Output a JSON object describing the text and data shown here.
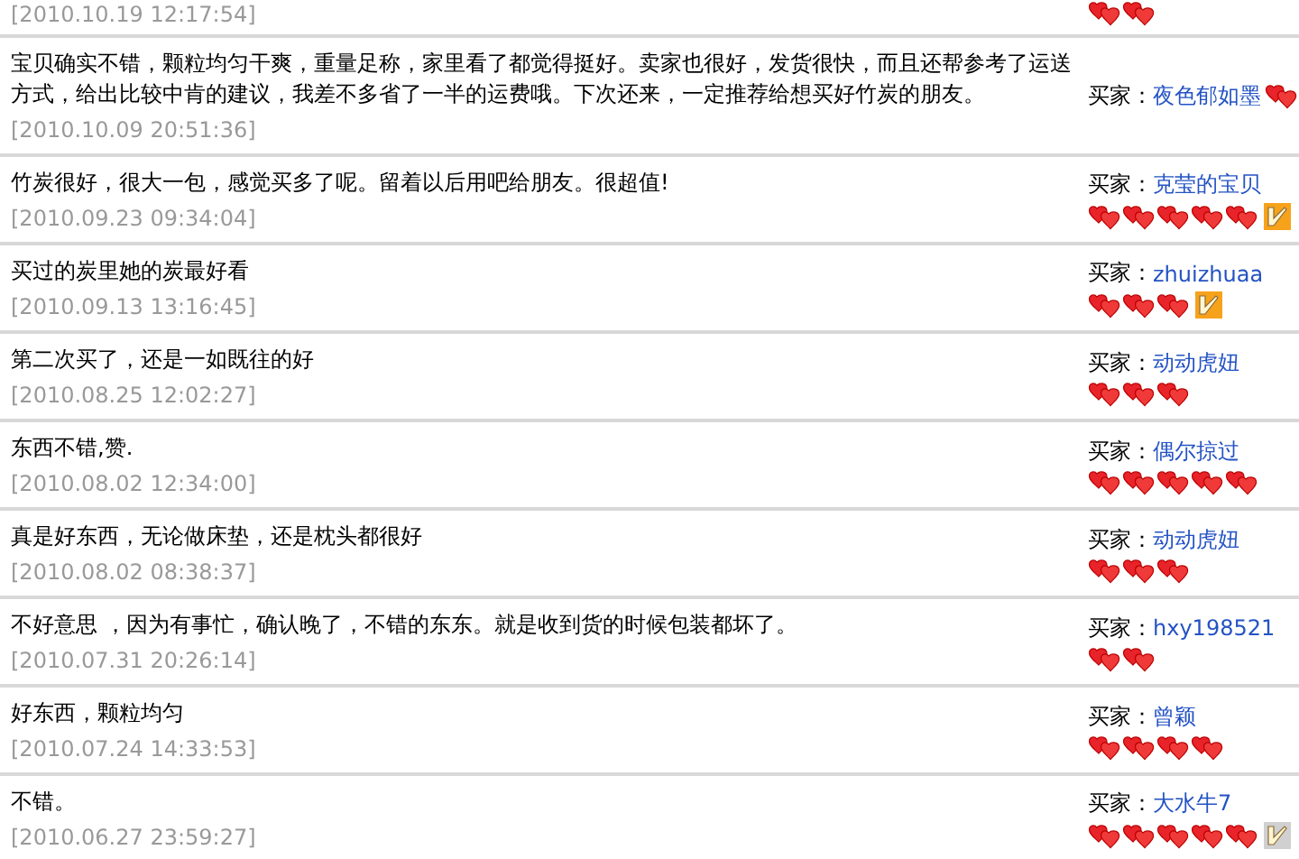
{
  "reviews": [
    {
      "date": "[2010.10.19 12:17:54]",
      "rank": [
        {
          "kind": "heart"
        },
        {
          "kind": "heart"
        }
      ]
    },
    {
      "comment": "宝贝确实不错，颗粒均匀干爽，重量足称，家里看了都觉得挺好。卖家也很好，发货很快，而且还帮参考了运送方式，给出比较中肯的建议，我差不多省了一半的运费哦。下次还来，一定推荐给想买好竹炭的朋友。",
      "date": "[2010.10.09 20:51:36]",
      "buyer_label": "买家：",
      "buyer": "夜色郁如墨",
      "rank": [
        {
          "kind": "heart"
        }
      ]
    },
    {
      "comment": "竹炭很好，很大一包，感觉买多了呢。留着以后用吧给朋友。很超值!",
      "date": "[2010.09.23 09:34:04]",
      "buyer_label": "买家：",
      "buyer": "克莹的宝贝",
      "rank": [
        {
          "kind": "heart"
        },
        {
          "kind": "heart"
        },
        {
          "kind": "heart"
        },
        {
          "kind": "heart"
        },
        {
          "kind": "heart"
        },
        {
          "kind": "badge",
          "color": "#f7a21b"
        }
      ]
    },
    {
      "comment": "买过的炭里她的炭最好看",
      "date": "[2010.09.13 13:16:45]",
      "buyer_label": "买家：",
      "buyer": "zhuizhuaa",
      "rank": [
        {
          "kind": "heart"
        },
        {
          "kind": "heart"
        },
        {
          "kind": "heart"
        },
        {
          "kind": "badge",
          "color": "#f7a21b"
        }
      ]
    },
    {
      "comment": "第二次买了，还是一如既往的好",
      "date": "[2010.08.25 12:02:27]",
      "buyer_label": "买家：",
      "buyer": "动动虎妞",
      "rank": [
        {
          "kind": "heart"
        },
        {
          "kind": "heart"
        },
        {
          "kind": "heart"
        }
      ]
    },
    {
      "comment": "东西不错,赞.",
      "date": "[2010.08.02 12:34:00]",
      "buyer_label": "买家：",
      "buyer": "偶尔掠过",
      "rank": [
        {
          "kind": "heart"
        },
        {
          "kind": "heart"
        },
        {
          "kind": "heart"
        },
        {
          "kind": "heart"
        },
        {
          "kind": "heart"
        }
      ]
    },
    {
      "comment": "真是好东西，无论做床垫，还是枕头都很好",
      "date": "[2010.08.02 08:38:37]",
      "buyer_label": "买家：",
      "buyer": "动动虎妞",
      "rank": [
        {
          "kind": "heart"
        },
        {
          "kind": "heart"
        },
        {
          "kind": "heart"
        }
      ]
    },
    {
      "comment": "不好意思 ，因为有事忙，确认晚了，不错的东东。就是收到货的时候包装都坏了。",
      "date": "[2010.07.31 20:26:14]",
      "buyer_label": "买家：",
      "buyer": "hxy198521",
      "rank": [
        {
          "kind": "heart"
        },
        {
          "kind": "heart"
        }
      ]
    },
    {
      "comment": "好东西，颗粒均匀",
      "date": "[2010.07.24 14:33:53]",
      "buyer_label": "买家：",
      "buyer": "曾颖",
      "rank": [
        {
          "kind": "heart"
        },
        {
          "kind": "heart"
        },
        {
          "kind": "heart"
        },
        {
          "kind": "heart"
        }
      ]
    },
    {
      "comment": "不错。",
      "date": "[2010.06.27 23:59:27]",
      "buyer_label": "买家：",
      "buyer": "大水牛7",
      "rank": [
        {
          "kind": "heart"
        },
        {
          "kind": "heart"
        },
        {
          "kind": "heart"
        },
        {
          "kind": "heart"
        },
        {
          "kind": "heart"
        },
        {
          "kind": "badge",
          "color": "#d0d0d0"
        }
      ]
    }
  ]
}
